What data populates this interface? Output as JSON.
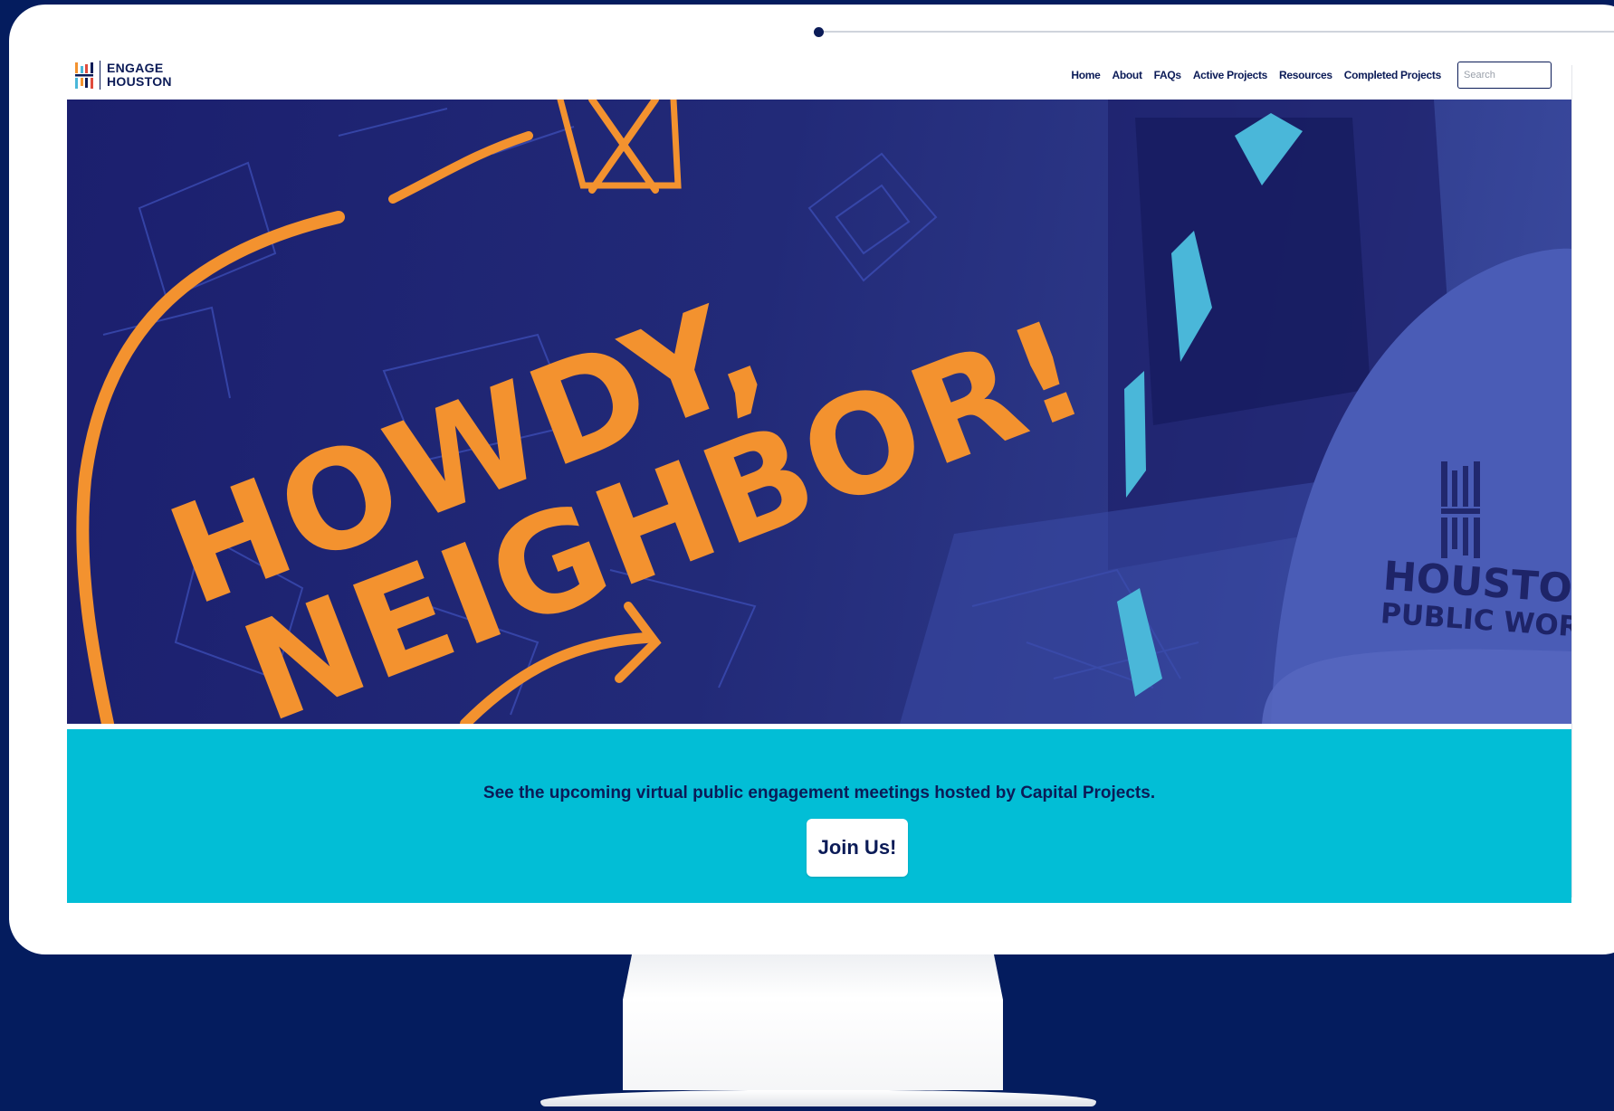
{
  "site": {
    "logo_line1": "ENGAGE",
    "logo_line2": "HOUSTON"
  },
  "nav": {
    "items": [
      {
        "label": "Home"
      },
      {
        "label": "About"
      },
      {
        "label": "FAQs"
      },
      {
        "label": "Active Projects"
      },
      {
        "label": "Resources"
      },
      {
        "label": "Completed Projects"
      }
    ],
    "search_placeholder": "Search"
  },
  "hero": {
    "line1": "HOWDY,",
    "line2": "NEIGHBOR!",
    "helmet_line1": "HOUSTON",
    "helmet_line2": "PUBLIC WORKS"
  },
  "cta": {
    "text": "See the upcoming virtual public engagement meetings hosted by Capital Projects.",
    "button_label": "Join Us!"
  },
  "colors": {
    "page_bg": "#041c5e",
    "navy": "#0b1b57",
    "orange": "#f3922f",
    "cyan_banner": "#02bed6",
    "hero_blue": "#222a78",
    "accent_cyan": "#4ab7d9"
  }
}
